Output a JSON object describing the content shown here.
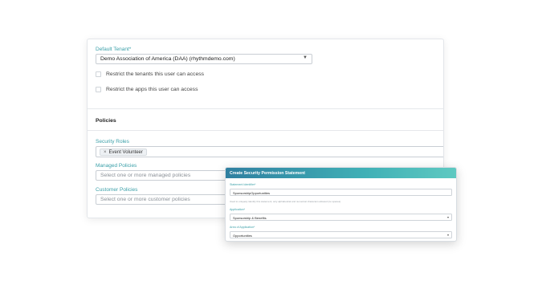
{
  "tenant_section": {
    "default_tenant_label": "Default Tenant*",
    "default_tenant_value": "Demo Association of America (DAA) (rhythmdemo.com)",
    "restrict_tenants_label": "Restrict the tenants this user can access",
    "restrict_apps_label": "Restrict the apps this user can access"
  },
  "policies_section": {
    "title": "Policies",
    "security_roles_label": "Security Roles",
    "security_roles_chips": [
      "Event Volunteer"
    ],
    "managed_policies_label": "Managed Policies",
    "managed_policies_placeholder": "Select one or more managed policies",
    "customer_policies_label": "Customer Policies",
    "customer_policies_placeholder": "Select one or more customer policies"
  },
  "modal": {
    "title": "Create Security Permission Statement",
    "statement_identifier_label": "Statement Identifier*",
    "statement_identifier_value": "SponsorshipOpportunities",
    "statement_identifier_help": "Used to uniquely identify this statement; only alphabetical and numerical characters allowed (no spaces)",
    "application_label": "Application*",
    "application_value": "Sponsorship & Benefits",
    "area_of_application_label": "Area of Application*",
    "area_of_application_value": "Opportunities"
  },
  "icons": {
    "dropdown": "chevron-down-icon",
    "chip_remove": "close-icon"
  },
  "colors": {
    "accent_teal": "#3a9fa8",
    "modal_header_start": "#2f7fa0",
    "modal_header_end": "#5ec9c1"
  }
}
